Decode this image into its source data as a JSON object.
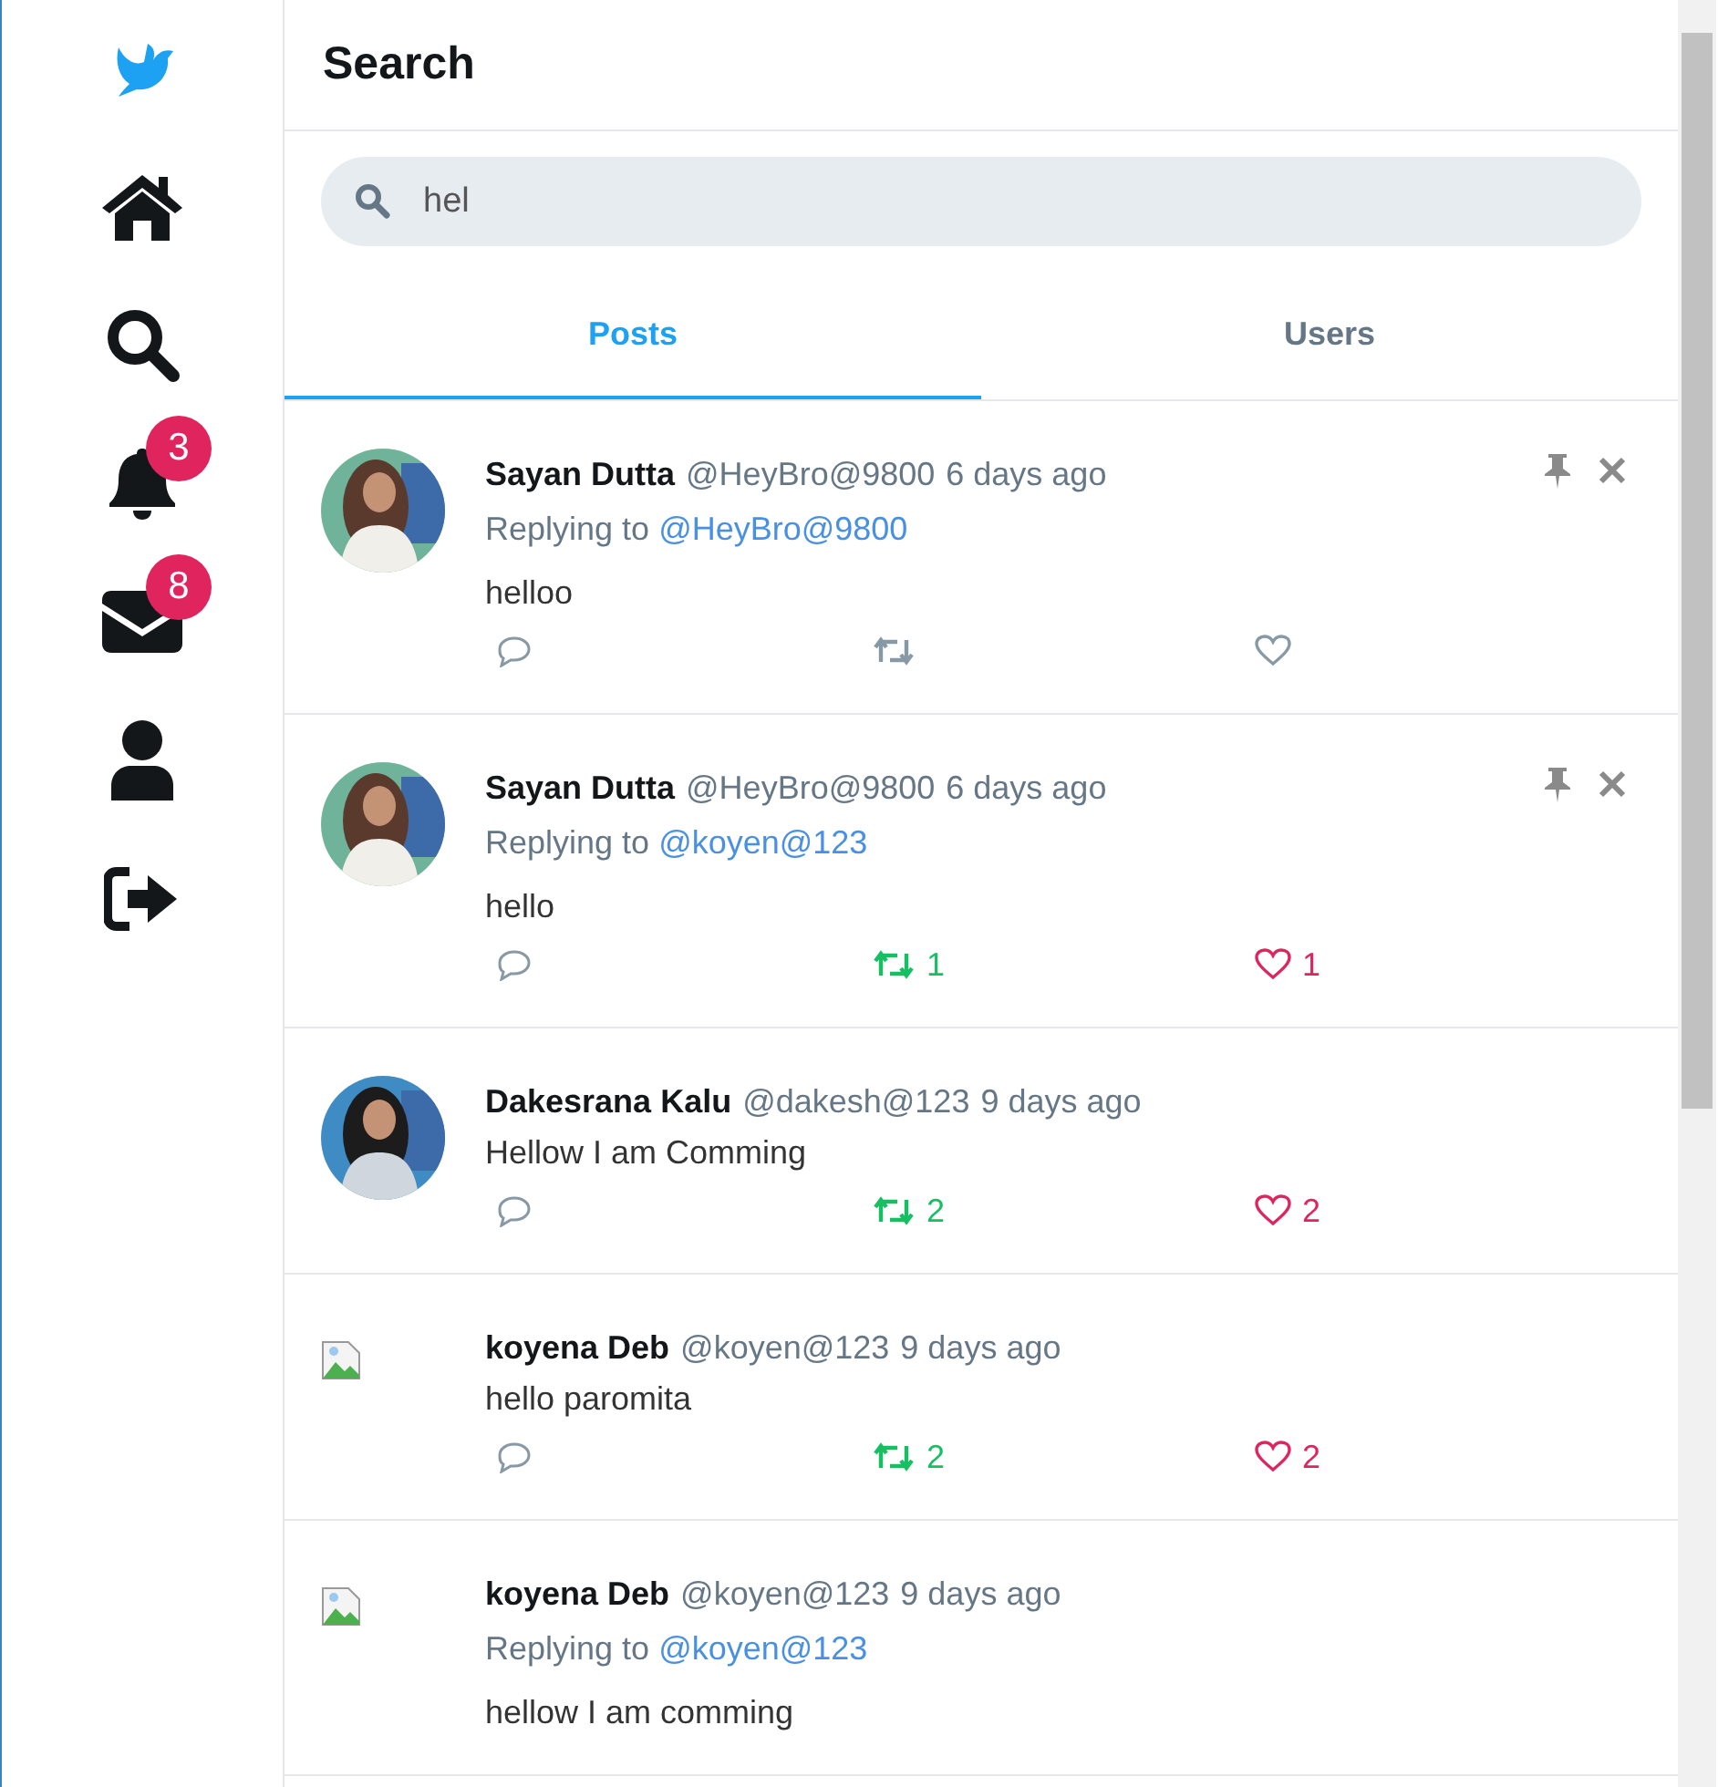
{
  "sidebar": {
    "items": [
      {
        "kind": "logo"
      },
      {
        "kind": "home"
      },
      {
        "kind": "search"
      },
      {
        "kind": "bell",
        "badge": "3"
      },
      {
        "kind": "mail",
        "badge": "8"
      },
      {
        "kind": "profile"
      },
      {
        "kind": "logout"
      }
    ]
  },
  "header": {
    "title": "Search"
  },
  "search": {
    "value": "hel"
  },
  "tabs": [
    {
      "label": "Posts",
      "selected": true
    },
    {
      "label": "Users",
      "selected": false
    }
  ],
  "posts": [
    {
      "image_loaded": true,
      "name": "Sayan Dutta",
      "handle": "@HeyBro@9800",
      "time": "6 days ago",
      "reply_prefix": "Replying to",
      "reply_to": "@HeyBro@9800",
      "text": "helloo",
      "own": true,
      "retweeted": false,
      "liked": false
    },
    {
      "image_loaded": true,
      "name": "Sayan Dutta",
      "handle": "@HeyBro@9800",
      "time": "6 days ago",
      "reply_prefix": "Replying to",
      "reply_to": "@koyen@123",
      "text": "hello",
      "own": true,
      "retweeted": true,
      "retweet_count": "1",
      "liked": true,
      "like_count": "1"
    },
    {
      "image_loaded": true,
      "name": "Dakesrana Kalu",
      "handle": "@dakesh@123",
      "time": "9 days ago",
      "text": "Hellow I am Comming",
      "own": false,
      "retweeted": true,
      "retweet_count": "2",
      "liked": true,
      "like_count": "2"
    },
    {
      "image_loaded": false,
      "name": "koyena Deb",
      "handle": "@koyen@123",
      "time": "9 days ago",
      "text": "hello paromita",
      "own": false,
      "retweeted": true,
      "retweet_count": "2",
      "liked": true,
      "like_count": "2"
    },
    {
      "image_loaded": false,
      "name": "koyena Deb",
      "handle": "@koyen@123",
      "time": "9 days ago",
      "reply_prefix": "Replying to",
      "reply_to": "@koyen@123",
      "text": "hellow I am comming",
      "own": false
    }
  ]
}
